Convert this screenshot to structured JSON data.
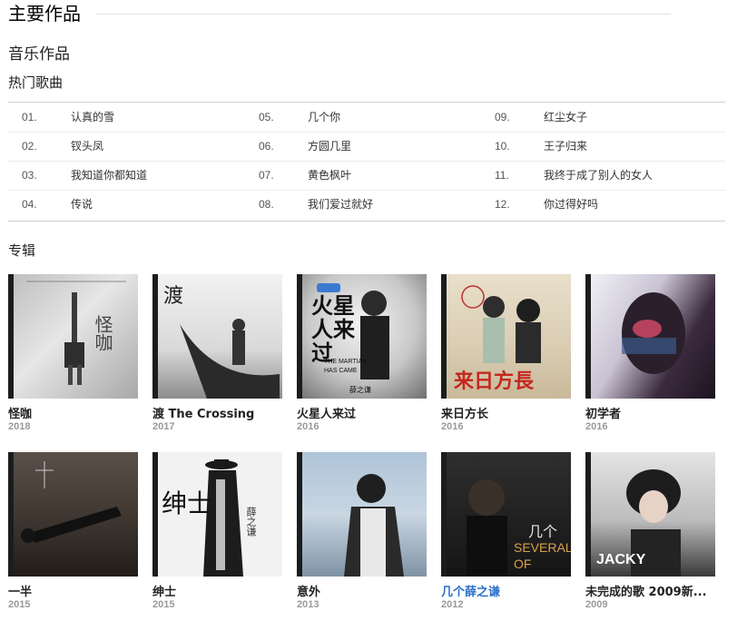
{
  "section_title": "主要作品",
  "subtitle": "音乐作品",
  "hot_songs_label": "热门歌曲",
  "songs": [
    {
      "no": "01.",
      "name": "认真的雪"
    },
    {
      "no": "02.",
      "name": "钗头凤"
    },
    {
      "no": "03.",
      "name": "我知道你都知道"
    },
    {
      "no": "04.",
      "name": "传说"
    },
    {
      "no": "05.",
      "name": "几个你"
    },
    {
      "no": "06.",
      "name": "方圆几里"
    },
    {
      "no": "07.",
      "name": "黄色枫叶"
    },
    {
      "no": "08.",
      "name": "我们爱过就好"
    },
    {
      "no": "09.",
      "name": "红尘女子"
    },
    {
      "no": "10.",
      "name": "王子归来"
    },
    {
      "no": "11.",
      "name": "我终于成了别人的女人"
    },
    {
      "no": "12.",
      "name": "你过得好吗"
    }
  ],
  "albums_label": "专辑",
  "albums": [
    {
      "title": "怪咖",
      "year": "2018",
      "cover_text": "怪咖"
    },
    {
      "title": "渡 The Crossing",
      "year": "2017",
      "cover_text": "渡"
    },
    {
      "title": "火星人来过",
      "year": "2016",
      "cover_text": "火星人来过",
      "cover_subtext": "THE MARTIAN HAS CAME",
      "cover_artist": "薛之谦"
    },
    {
      "title": "来日方长",
      "year": "2016",
      "cover_text": "来日方長"
    },
    {
      "title": "初学者",
      "year": "2016"
    },
    {
      "title": "一半",
      "year": "2015"
    },
    {
      "title": "绅士",
      "year": "2015",
      "cover_text": "绅士",
      "cover_artist": "薛之谦"
    },
    {
      "title": "意外",
      "year": "2013"
    },
    {
      "title": "几个薛之谦",
      "year": "2012",
      "cover_text": "几个",
      "cover_subtext": "SEVERAL OF"
    },
    {
      "title": "未完成的歌 2009新...",
      "year": "2009",
      "cover_text": "JACKY"
    }
  ],
  "colors": {
    "link": "#2a6fc9",
    "year": "#999999",
    "rule": "#cfcfcf"
  }
}
